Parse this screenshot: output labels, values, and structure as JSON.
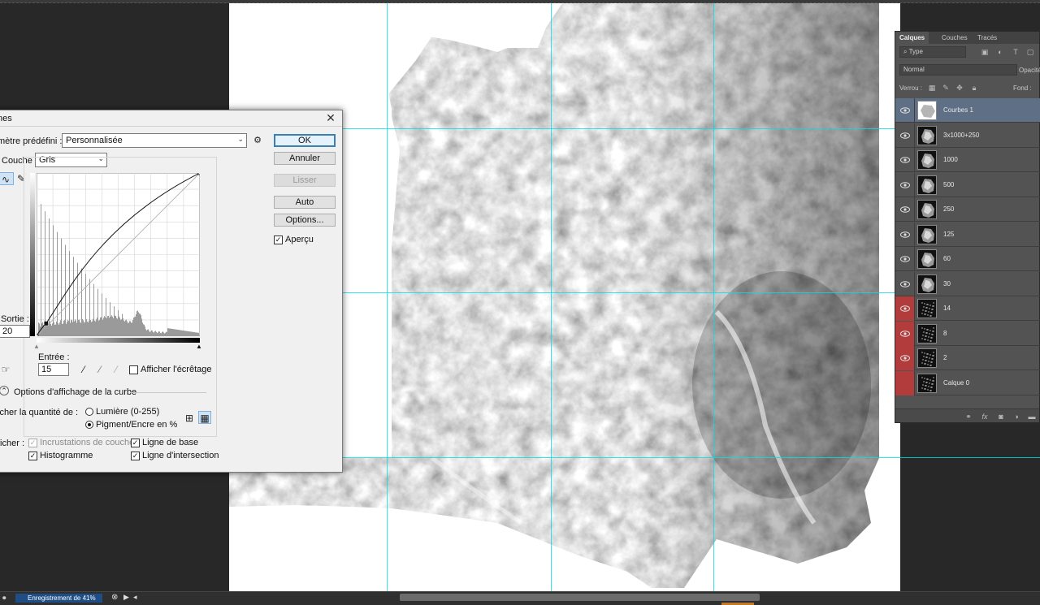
{
  "curves_dialog": {
    "title": "nes",
    "preset_label": "mètre prédéfini :",
    "preset_value": "Personnalisée",
    "channel_label": "Couche :",
    "channel_value": "Gris",
    "output_label": "Sortie :",
    "output_value": "20",
    "input_label": "Entrée :",
    "input_value": "15",
    "clipping_label": "Afficher l'écrêtage",
    "curve_display_options": "Options d'affichage de la curbe",
    "show_amount_label": "icher la quantité de :",
    "light_option": "Lumière (0-255)",
    "pigment_option": "Pigment/Encre en %",
    "show_label": "ficher :",
    "channel_overlays": "Incrustations de couche",
    "baseline": "Ligne de base",
    "histogram": "Histogramme",
    "intersection_line": "Ligne d'intersection",
    "buttons": {
      "ok": "OK",
      "cancel": "Annuler",
      "smooth": "Lisser",
      "auto": "Auto",
      "options": "Options..."
    },
    "preview_label": "Aperçu",
    "preview_checked": true,
    "curve_points": [
      [
        0,
        0
      ],
      [
        15,
        20
      ],
      [
        255,
        255
      ]
    ],
    "histogram_levels": "dense peaks at low tones, bump near 65%"
  },
  "layers_panel": {
    "tabs": [
      "Calques",
      "Couches",
      "Tracés"
    ],
    "active_tab": "Calques",
    "filter_placeholder": "Type",
    "blend_mode": "Normal",
    "opacity_label": "Opacité :",
    "lock_label": "Verrou :",
    "fill_label": "Fond :",
    "layers": [
      {
        "name": "Courbes 1",
        "eye": "normal",
        "selected": true,
        "thumb": "white"
      },
      {
        "name": "3x1000+250",
        "eye": "normal",
        "selected": false,
        "thumb": "map"
      },
      {
        "name": "1000",
        "eye": "normal",
        "selected": false,
        "thumb": "map"
      },
      {
        "name": "500",
        "eye": "normal",
        "selected": false,
        "thumb": "map"
      },
      {
        "name": "250",
        "eye": "normal",
        "selected": false,
        "thumb": "map"
      },
      {
        "name": "125",
        "eye": "normal",
        "selected": false,
        "thumb": "map"
      },
      {
        "name": "60",
        "eye": "normal",
        "selected": false,
        "thumb": "map"
      },
      {
        "name": "30",
        "eye": "normal",
        "selected": false,
        "thumb": "map"
      },
      {
        "name": "14",
        "eye": "red",
        "selected": false,
        "thumb": "dots"
      },
      {
        "name": "8",
        "eye": "red",
        "selected": false,
        "thumb": "dots"
      },
      {
        "name": "2",
        "eye": "red",
        "selected": false,
        "thumb": "dots"
      },
      {
        "name": "Calque 0",
        "eye": "red-hidden",
        "selected": false,
        "thumb": "dots"
      }
    ]
  },
  "status_bar": {
    "progress_text": "Enregistrement de 41%",
    "progress_percent": 41
  },
  "colors": {
    "guide": "#00e0e8",
    "selection": "#5f6f86",
    "red_eye": "#b23c3c",
    "progress": "#1f4d86"
  }
}
